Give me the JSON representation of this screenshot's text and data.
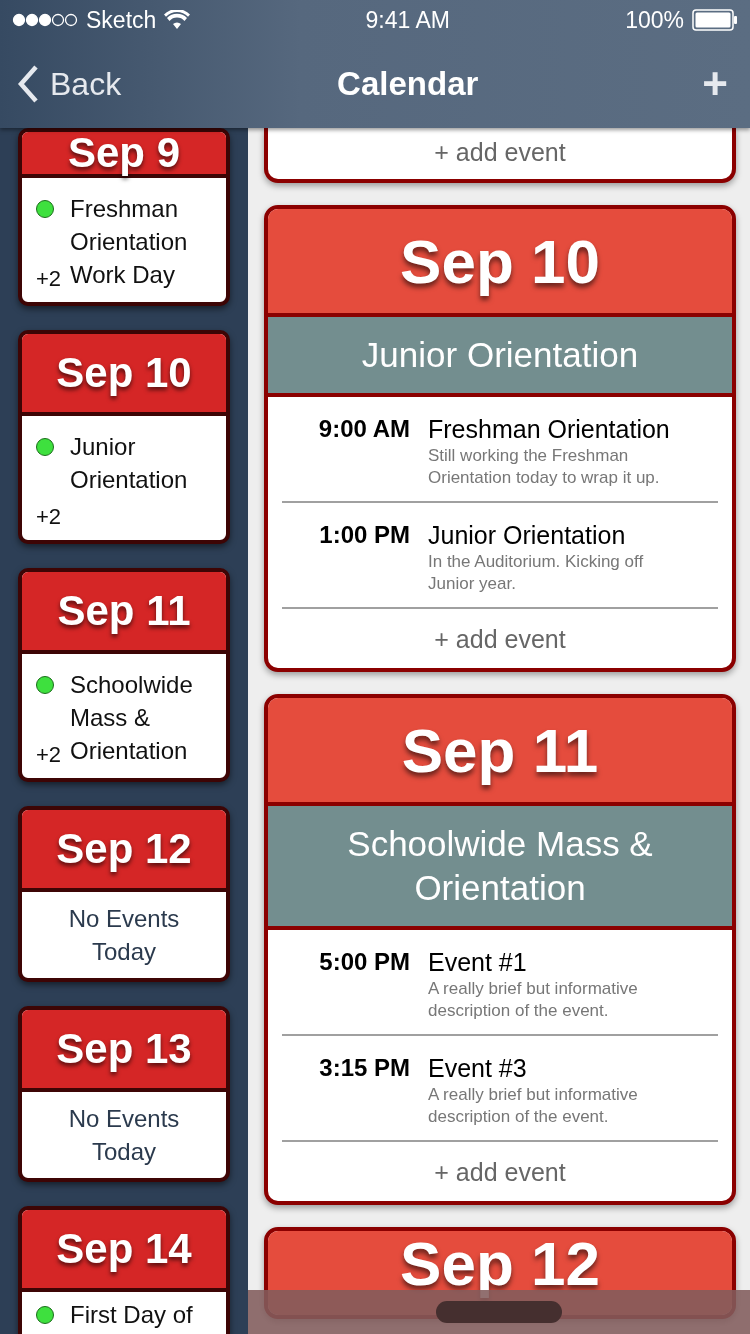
{
  "status_bar": {
    "carrier": "Sketch",
    "time": "9:41 AM",
    "battery": "100%"
  },
  "nav": {
    "back": "Back",
    "title": "Calendar",
    "add": "+"
  },
  "day_list": [
    {
      "kind": "events",
      "date": "Sep 9",
      "first_event": "Freshman Orientation Work Day",
      "more": "+2"
    },
    {
      "kind": "events",
      "date": "Sep 10",
      "first_event": "Junior Orientation",
      "more": "+2"
    },
    {
      "kind": "events",
      "date": "Sep 11",
      "first_event": "Schoolwide Mass & Orientation",
      "more": "+2"
    },
    {
      "kind": "empty",
      "date": "Sep 12",
      "empty_text": "No Events Today"
    },
    {
      "kind": "empty",
      "date": "Sep 13",
      "empty_text": "No Events Today"
    },
    {
      "kind": "events",
      "date": "Sep 14",
      "first_event": "First Day of"
    }
  ],
  "day_details": [
    {
      "kind": "tail",
      "add_label": "+ add event"
    },
    {
      "kind": "full",
      "date": "Sep 10",
      "heading": "Junior Orientation",
      "events": [
        {
          "time": "9:00 AM",
          "title": "Freshman Orientation",
          "description": "Still working the Freshman Orientation today to wrap it up."
        },
        {
          "time": "1:00 PM",
          "title": "Junior Orientation",
          "description": "In the Auditorium. Kicking off Junior year."
        }
      ],
      "add_label": "+ add event"
    },
    {
      "kind": "full",
      "date": "Sep 11",
      "heading": "Schoolwide Mass & Orientation",
      "events": [
        {
          "time": "5:00 PM",
          "title": "Event #1",
          "description": "A really brief but informative description of the event."
        },
        {
          "time": "3:15 PM",
          "title": "Event #3",
          "description": "A really brief but informative description of the event."
        }
      ],
      "add_label": "+ add event"
    },
    {
      "kind": "head",
      "date": "Sep 12"
    }
  ]
}
